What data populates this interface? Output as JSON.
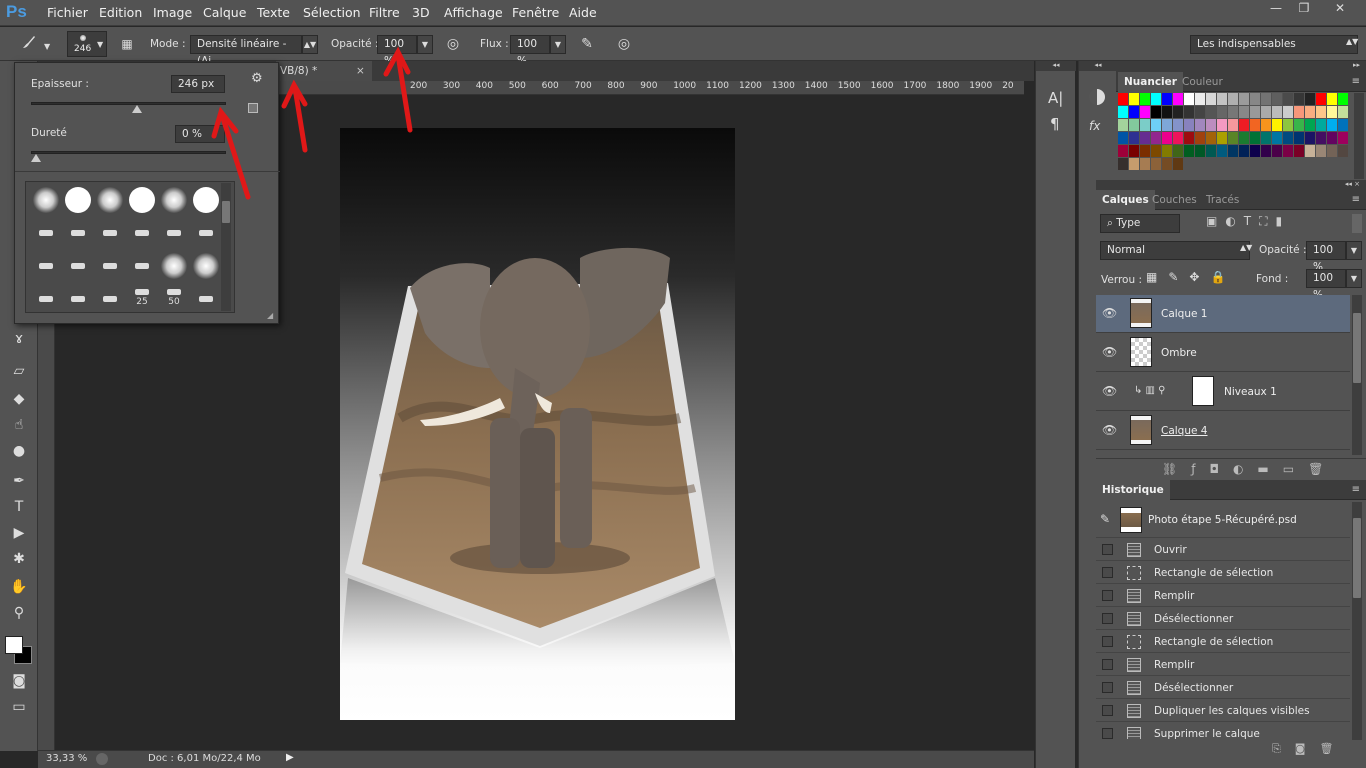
{
  "app": {
    "logo": "Ps",
    "window_buttons": [
      "—",
      "❐",
      "✕"
    ]
  },
  "menu": [
    "Fichier",
    "Edition",
    "Image",
    "Calque",
    "Texte",
    "Sélection",
    "Filtre",
    "3D",
    "Affichage",
    "Fenêtre",
    "Aide"
  ],
  "options": {
    "brush_size": "246",
    "mode_label": "Mode :",
    "mode_value": "Densité linéaire - (Aj...",
    "opacity_label": "Opacité :",
    "opacity_value": "100 %",
    "flow_label": "Flux :",
    "flow_value": "100 %",
    "workspace": "Les indispensables"
  },
  "brush_panel": {
    "size_label": "Epaisseur :",
    "size_value": "246 px",
    "size_fraction": 0.62,
    "hardness_label": "Dureté",
    "hardness_value": "0 %",
    "hardness_fraction": 0.0,
    "presets_numbers": [
      "25",
      "50"
    ]
  },
  "document": {
    "tab_title": "VB/8) *",
    "zoom": "33,33 %",
    "doc_info": "Doc : 6,01 Mo/22,4 Mo"
  },
  "ruler": {
    "h": [
      "200",
      "300",
      "400",
      "500",
      "600",
      "700",
      "800",
      "900",
      "1000",
      "1100",
      "1200",
      "1300",
      "1400",
      "1500",
      "1600",
      "1700",
      "1800",
      "1900",
      "20"
    ]
  },
  "swatches": {
    "tabs": [
      "Nuancier",
      "Couleur"
    ],
    "colors": [
      [
        "#ff0000",
        "#ffff00",
        "#00ff00",
        "#00ffff",
        "#0000ff",
        "#ff00ff",
        "#ffffff",
        "#ebebeb",
        "#d7d7d7",
        "#c3c3c3",
        "#afafaf",
        "#9b9b9b",
        "#878787",
        "#737373",
        "#5f5f5f",
        "#4b4b4b",
        "#373737",
        "#232323",
        "#ff0000",
        "#ffff00",
        "#00ff00"
      ],
      [
        "#00ffff",
        "#0000ff",
        "#ff00ff",
        "#000000",
        "#111111",
        "#222222",
        "#333333",
        "#444444",
        "#555555",
        "#666666",
        "#777777",
        "#888888",
        "#999999",
        "#aaaaaa",
        "#bbbbbb",
        "#cccccc",
        "#f7977a",
        "#f9ad81",
        "#fdc68a",
        "#fff79a",
        "#c4df9b"
      ],
      [
        "#a3d39c",
        "#82ca9d",
        "#7bcdc8",
        "#6ecff6",
        "#7ea7d8",
        "#8493ca",
        "#8882be",
        "#a187be",
        "#bc8dbf",
        "#f49ac2",
        "#f6989d",
        "#ed1c24",
        "#f26522",
        "#f7941d",
        "#fff200",
        "#8dc63f",
        "#39b54a",
        "#00a651",
        "#00a99d",
        "#00aeef",
        "#0072bc"
      ],
      [
        "#0054a6",
        "#2e3192",
        "#662d91",
        "#92278f",
        "#ec008c",
        "#ed145b",
        "#9e0b0f",
        "#a0410d",
        "#a3620a",
        "#aba000",
        "#598527",
        "#1a7b30",
        "#007236",
        "#00746b",
        "#0076a3",
        "#004b80",
        "#003471",
        "#1b1464",
        "#440e62",
        "#630460",
        "#9e005d"
      ],
      [
        "#9e0039",
        "#790000",
        "#7b2e00",
        "#7d4900",
        "#827b00",
        "#406618",
        "#005e20",
        "#005826",
        "#005952",
        "#005b7f",
        "#003663",
        "#002157",
        "#0d004c",
        "#32004b",
        "#4b0049",
        "#7b0046",
        "#7a0026",
        "#c7b299",
        "#998675",
        "#736357",
        "#534741"
      ],
      [
        "#362f2d",
        "#c69c6d",
        "#a67c52",
        "#8c6239",
        "#754c24",
        "#603913"
      ]
    ]
  },
  "layers": {
    "tabs": [
      "Calques",
      "Couches",
      "Tracés"
    ],
    "filter": "Type",
    "blend": "Normal",
    "opacity_label": "Opacité :",
    "opacity_value": "100 %",
    "lock_label": "Verrou :",
    "fill_label": "Fond :",
    "fill_value": "100 %",
    "items": [
      {
        "name": "Calque 1",
        "selected": true
      },
      {
        "name": "Ombre",
        "selected": false
      },
      {
        "name": "Niveaux 1",
        "selected": false
      },
      {
        "name": "Calque 4",
        "selected": false
      }
    ]
  },
  "history": {
    "tab": "Historique",
    "snapshot": "Photo étape 5-Récupéré.psd",
    "items": [
      {
        "label": "Ouvrir",
        "icon": "doc"
      },
      {
        "label": "Rectangle de sélection",
        "icon": "sel"
      },
      {
        "label": "Remplir",
        "icon": "fill"
      },
      {
        "label": "Désélectionner",
        "icon": "doc"
      },
      {
        "label": "Rectangle de sélection",
        "icon": "sel"
      },
      {
        "label": "Remplir",
        "icon": "fill"
      },
      {
        "label": "Désélectionner",
        "icon": "doc"
      },
      {
        "label": "Dupliquer les calques visibles",
        "icon": "doc"
      },
      {
        "label": "Supprimer le calque",
        "icon": "doc"
      }
    ]
  }
}
